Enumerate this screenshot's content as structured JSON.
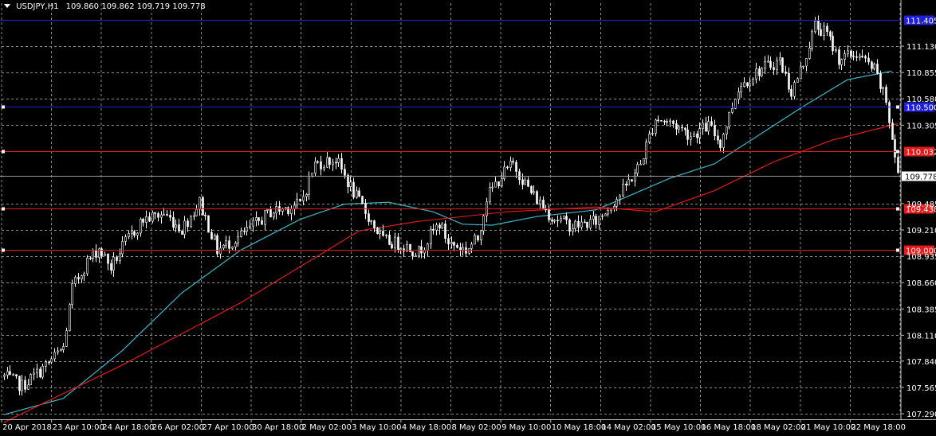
{
  "header": {
    "symbol": "USDJPY,H1",
    "ohlc": "109.860 109.862 109.719 109.778"
  },
  "colors": {
    "background": "#000000",
    "grid": "#8a8a8a",
    "candle": "#ffffff",
    "ma_fast": "#3fb8c8",
    "ma_slow": "#e01b1b",
    "level_blue": "#1f1fd6",
    "level_red": "#e01b1b",
    "current_price": "#ffffff",
    "axis_text": "#ffffff"
  },
  "chart_data": {
    "type": "candlestick",
    "instrument": "USDJPY",
    "timeframe": "H1",
    "last_bar": {
      "open": 109.86,
      "high": 109.862,
      "low": 109.719,
      "close": 109.778
    },
    "y_ticks": [
      "111.405",
      "111.130",
      "110.855",
      "110.580",
      "110.305",
      "110.032",
      "109.778",
      "109.485",
      "109.210",
      "109.000",
      "108.935",
      "108.660",
      "108.385",
      "108.110",
      "107.840",
      "107.565",
      "107.290"
    ],
    "ylim": [
      107.29,
      111.405
    ],
    "x_ticks": [
      "20 Apr 2018",
      "23 Apr 10:00",
      "24 Apr 18:00",
      "26 Apr 02:00",
      "27 Apr 10:00",
      "30 Apr 18:00",
      "2 May 02:00",
      "3 May 10:00",
      "4 May 18:00",
      "8 May 02:00",
      "9 May 10:00",
      "10 May 18:00",
      "14 May 02:00",
      "15 May 10:00",
      "16 May 18:00",
      "18 May 02:00",
      "21 May 10:00",
      "22 May 18:00"
    ],
    "horizontal_levels": [
      {
        "price": 111.405,
        "label": "111.405",
        "color": "blue"
      },
      {
        "price": 110.5,
        "label": "110.500",
        "color": "blue"
      },
      {
        "price": 110.032,
        "label": "110.032",
        "color": "red"
      },
      {
        "price": 109.438,
        "label": "109.438",
        "color": "red"
      },
      {
        "price": 109.0,
        "label": "109.000",
        "color": "red"
      }
    ],
    "current_price": {
      "price": 109.778,
      "label": "109.778"
    },
    "close_path": [
      [
        0,
        107.68
      ],
      [
        6,
        107.58
      ],
      [
        14,
        107.79
      ],
      [
        20,
        107.98
      ],
      [
        23,
        108.6
      ],
      [
        28,
        108.88
      ],
      [
        32,
        109.02
      ],
      [
        36,
        108.82
      ],
      [
        41,
        109.08
      ],
      [
        47,
        109.32
      ],
      [
        54,
        109.38
      ],
      [
        60,
        109.22
      ],
      [
        66,
        109.5
      ],
      [
        72,
        109.0
      ],
      [
        80,
        109.15
      ],
      [
        90,
        109.4
      ],
      [
        100,
        109.48
      ],
      [
        105,
        109.9
      ],
      [
        112,
        109.95
      ],
      [
        118,
        109.6
      ],
      [
        124,
        109.3
      ],
      [
        128,
        109.1
      ],
      [
        135,
        109.05
      ],
      [
        140,
        108.98
      ],
      [
        147,
        109.28
      ],
      [
        150,
        109.08
      ],
      [
        156,
        109.0
      ],
      [
        160,
        109.12
      ],
      [
        163,
        109.55
      ],
      [
        168,
        109.78
      ],
      [
        172,
        109.9
      ],
      [
        178,
        109.6
      ],
      [
        185,
        109.35
      ],
      [
        192,
        109.25
      ],
      [
        200,
        109.3
      ],
      [
        208,
        109.58
      ],
      [
        215,
        109.9
      ],
      [
        220,
        110.38
      ],
      [
        226,
        110.32
      ],
      [
        232,
        110.2
      ],
      [
        238,
        110.3
      ],
      [
        242,
        110.12
      ],
      [
        248,
        110.7
      ],
      [
        255,
        110.88
      ],
      [
        262,
        110.98
      ],
      [
        266,
        110.65
      ],
      [
        270,
        110.95
      ],
      [
        274,
        111.35
      ],
      [
        278,
        111.25
      ],
      [
        282,
        111.0
      ],
      [
        288,
        111.05
      ],
      [
        294,
        110.88
      ],
      [
        298,
        110.55
      ],
      [
        302,
        109.78
      ]
    ],
    "series": [
      {
        "name": "",
        "color": "cyan",
        "points": [
          [
            0,
            107.28
          ],
          [
            20,
            107.45
          ],
          [
            40,
            107.95
          ],
          [
            60,
            108.55
          ],
          [
            80,
            109.0
          ],
          [
            100,
            109.32
          ],
          [
            115,
            109.48
          ],
          [
            130,
            109.5
          ],
          [
            145,
            109.4
          ],
          [
            155,
            109.27
          ],
          [
            165,
            109.26
          ],
          [
            180,
            109.35
          ],
          [
            200,
            109.42
          ],
          [
            210,
            109.55
          ],
          [
            225,
            109.75
          ],
          [
            240,
            109.9
          ],
          [
            255,
            110.2
          ],
          [
            270,
            110.5
          ],
          [
            285,
            110.78
          ],
          [
            300,
            110.87
          ]
        ]
      },
      {
        "name": "",
        "color": "red",
        "points": [
          [
            0,
            107.2
          ],
          [
            40,
            107.8
          ],
          [
            80,
            108.45
          ],
          [
            120,
            109.2
          ],
          [
            140,
            109.3
          ],
          [
            170,
            109.4
          ],
          [
            200,
            109.45
          ],
          [
            220,
            109.4
          ],
          [
            240,
            109.62
          ],
          [
            260,
            109.92
          ],
          [
            280,
            110.15
          ],
          [
            302,
            110.32
          ]
        ]
      }
    ]
  }
}
